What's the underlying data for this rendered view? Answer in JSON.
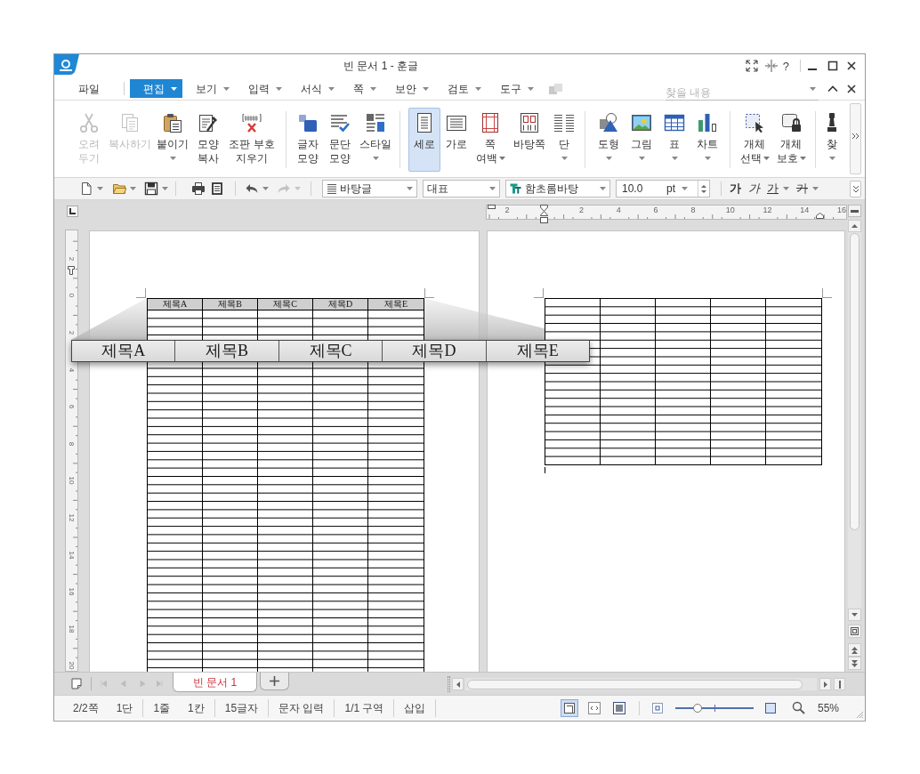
{
  "window": {
    "title": "빈 문서 1 - 훈글",
    "help": "?"
  },
  "menu_bar": {
    "items": [
      {
        "label": "파일",
        "selected": false,
        "dropdown": false
      },
      {
        "label": "편집",
        "selected": true,
        "dropdown": true
      },
      {
        "label": "보기",
        "selected": false,
        "dropdown": true
      },
      {
        "label": "입력",
        "selected": false,
        "dropdown": true
      },
      {
        "label": "서식",
        "selected": false,
        "dropdown": true
      },
      {
        "label": "쪽",
        "selected": false,
        "dropdown": true
      },
      {
        "label": "보안",
        "selected": false,
        "dropdown": true
      },
      {
        "label": "검토",
        "selected": false,
        "dropdown": true
      },
      {
        "label": "도구",
        "selected": false,
        "dropdown": true
      }
    ],
    "search": {
      "placeholder": "찾을 내용"
    }
  },
  "ribbon": {
    "groups": [
      {
        "buttons": [
          {
            "lines": [
              "오려",
              "두기"
            ],
            "dropdown": false,
            "disabled": true,
            "selected": false
          },
          {
            "lines": [
              "복사하기"
            ],
            "dropdown": false,
            "disabled": true,
            "selected": false
          },
          {
            "lines": [
              "붙이기"
            ],
            "dropdown": true,
            "disabled": false,
            "selected": false
          },
          {
            "lines": [
              "모양",
              "복사"
            ],
            "dropdown": false,
            "disabled": false,
            "selected": false
          },
          {
            "lines": [
              "조판 부호",
              "지우기"
            ],
            "dropdown": false,
            "disabled": false,
            "selected": false
          }
        ]
      },
      {
        "buttons": [
          {
            "lines": [
              "글자",
              "모양"
            ],
            "dropdown": false,
            "disabled": false,
            "selected": false
          },
          {
            "lines": [
              "문단",
              "모양"
            ],
            "dropdown": false,
            "disabled": false,
            "selected": false
          },
          {
            "lines": [
              "스타일"
            ],
            "dropdown": true,
            "disabled": false,
            "selected": false
          }
        ]
      },
      {
        "buttons": [
          {
            "lines": [
              "세로"
            ],
            "dropdown": false,
            "disabled": false,
            "selected": true
          },
          {
            "lines": [
              "가로"
            ],
            "dropdown": false,
            "disabled": false,
            "selected": false
          },
          {
            "lines": [
              "쪽",
              "여백"
            ],
            "dropdown": true,
            "disabled": false,
            "selected": false
          },
          {
            "lines": [
              "바탕쪽"
            ],
            "dropdown": false,
            "disabled": false,
            "selected": false
          },
          {
            "lines": [
              "단"
            ],
            "dropdown": true,
            "disabled": false,
            "selected": false
          }
        ]
      },
      {
        "buttons": [
          {
            "lines": [
              "도형"
            ],
            "dropdown": true,
            "disabled": false,
            "selected": false
          },
          {
            "lines": [
              "그림"
            ],
            "dropdown": true,
            "disabled": false,
            "selected": false
          },
          {
            "lines": [
              "표"
            ],
            "dropdown": true,
            "disabled": false,
            "selected": false
          },
          {
            "lines": [
              "차트"
            ],
            "dropdown": true,
            "disabled": false,
            "selected": false
          }
        ]
      },
      {
        "buttons": [
          {
            "lines": [
              "개체",
              "선택"
            ],
            "dropdown": true,
            "disabled": false,
            "selected": false
          },
          {
            "lines": [
              "개체",
              "보호"
            ],
            "dropdown": true,
            "disabled": false,
            "selected": false
          }
        ]
      },
      {
        "buttons": [
          {
            "lines": [
              "찾"
            ],
            "dropdown": true,
            "disabled": false,
            "selected": false
          }
        ]
      }
    ]
  },
  "toolbar": {
    "groups": [
      {
        "buttons": [
          {
            "dropdown": true,
            "disabled": false
          },
          {
            "dropdown": true,
            "disabled": false
          },
          {
            "dropdown": true,
            "disabled": false
          }
        ]
      },
      {
        "buttons": [
          {
            "dropdown": false,
            "disabled": false
          },
          {
            "dropdown": false,
            "disabled": false
          }
        ]
      },
      {
        "buttons": [
          {
            "dropdown": true,
            "disabled": false
          },
          {
            "dropdown": true,
            "disabled": true
          }
        ]
      }
    ],
    "paragraph_style": "바탕글",
    "outline_style": "대표",
    "font": "함초롬바탕",
    "font_size": "10.0",
    "unit": "pt",
    "format_buttons": [
      {
        "label": "가",
        "kind": "bold",
        "dropdown": false
      },
      {
        "label": "가",
        "kind": "italic",
        "dropdown": false
      },
      {
        "label": "가",
        "kind": "underline",
        "dropdown": true
      },
      {
        "label": "가",
        "kind": "strikethrough",
        "dropdown": true
      }
    ]
  },
  "document": {
    "vertical_ruler": [
      "2",
      "0",
      "2",
      "4",
      "6",
      "8",
      "10",
      "12",
      "14",
      "16",
      "18",
      "20"
    ],
    "horizontal_ruler": {
      "before_origin": [
        "2"
      ],
      "after_origin": [
        "2",
        "4",
        "6",
        "8",
        "10",
        "12",
        "14",
        "16"
      ]
    },
    "table_header": [
      "제목A",
      "제목B",
      "제목C",
      "제목D",
      "제목E"
    ],
    "magnified_header": [
      "제목A",
      "제목B",
      "제목C",
      "제목D",
      "제목E"
    ]
  },
  "tab_bar": {
    "navigation_disabled": true,
    "tabs": [
      {
        "label": "빈 문서 1",
        "selected": true
      }
    ]
  },
  "status_bar": {
    "groups": [
      [
        "2/2쪽",
        "1단"
      ],
      [
        "1줄",
        "1칸"
      ],
      [
        "15글자"
      ],
      [
        "문자 입력"
      ],
      [
        "1/1 구역"
      ],
      [
        "삽입"
      ]
    ],
    "view_buttons": [
      {
        "selected": true
      },
      {
        "selected": false
      },
      {
        "selected": false
      }
    ],
    "zoom": {
      "level": 0.28,
      "reading": "55%"
    }
  }
}
